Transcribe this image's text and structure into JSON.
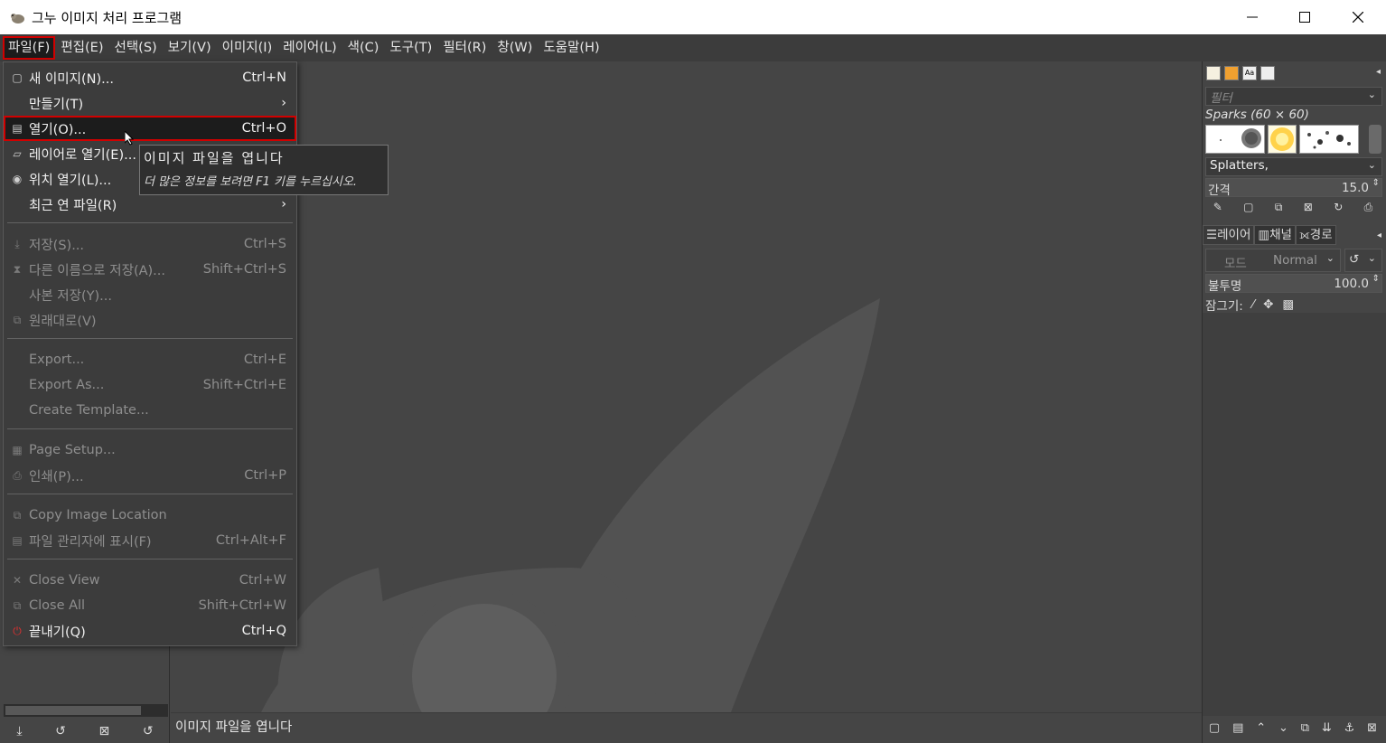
{
  "window": {
    "title": "그누 이미지 처리 프로그램"
  },
  "menubar": [
    {
      "label": "파일(F)",
      "active": true
    },
    {
      "label": "편집(E)"
    },
    {
      "label": "선택(S)"
    },
    {
      "label": "보기(V)"
    },
    {
      "label": "이미지(I)"
    },
    {
      "label": "레이어(L)"
    },
    {
      "label": "색(C)"
    },
    {
      "label": "도구(T)"
    },
    {
      "label": "필터(R)"
    },
    {
      "label": "창(W)"
    },
    {
      "label": "도움말(H)"
    }
  ],
  "file_menu": {
    "items": [
      {
        "label": "새 이미지(N)...",
        "shortcut": "Ctrl+N",
        "icon": "new-image-icon"
      },
      {
        "label": "만들기(T)",
        "shortcut": "",
        "submenu": true
      },
      {
        "label": "열기(O)...",
        "shortcut": "Ctrl+O",
        "icon": "open-icon",
        "highlighted": true
      },
      {
        "label": "레이어로 열기(E)...",
        "shortcut": "",
        "icon": "open-as-layers-icon"
      },
      {
        "label": "위치 열기(L)...",
        "shortcut": "",
        "icon": "open-location-icon"
      },
      {
        "label": "최근 연 파일(R)",
        "shortcut": "",
        "submenu": true
      },
      {
        "label": "저장(S)...",
        "shortcut": "Ctrl+S",
        "icon": "save-icon",
        "disabled": true
      },
      {
        "label": "다른 이름으로 저장(A)...",
        "shortcut": "Shift+Ctrl+S",
        "icon": "save-as-icon",
        "disabled": true
      },
      {
        "label": "사본 저장(Y)...",
        "shortcut": "",
        "disabled": true
      },
      {
        "label": "원래대로(V)",
        "shortcut": "",
        "icon": "revert-icon",
        "disabled": true
      },
      {
        "label": "Export...",
        "shortcut": "Ctrl+E",
        "disabled": true
      },
      {
        "label": "Export As...",
        "shortcut": "Shift+Ctrl+E",
        "disabled": true
      },
      {
        "label": "Create Template...",
        "shortcut": "",
        "disabled": true
      },
      {
        "label": "Page Setup...",
        "shortcut": "",
        "icon": "page-setup-icon",
        "disabled": true
      },
      {
        "label": "인쇄(P)...",
        "shortcut": "Ctrl+P",
        "icon": "print-icon",
        "disabled": true
      },
      {
        "label": "Copy Image Location",
        "shortcut": "",
        "icon": "copy-location-icon",
        "disabled": true
      },
      {
        "label": "파일 관리자에 표시(F)",
        "shortcut": "Ctrl+Alt+F",
        "icon": "file-manager-icon",
        "disabled": true
      },
      {
        "label": "Close View",
        "shortcut": "Ctrl+W",
        "icon": "close-view-icon",
        "disabled": true
      },
      {
        "label": "Close All",
        "shortcut": "Shift+Ctrl+W",
        "icon": "close-all-icon",
        "disabled": true
      },
      {
        "label": "끝내기(Q)",
        "shortcut": "Ctrl+Q",
        "icon": "quit-icon"
      }
    ]
  },
  "tooltip": {
    "title": "이미지 파일을 엽니다",
    "hint": "더 많은 정보를 보려면 F1 키를 누르십시오."
  },
  "statusbar": {
    "text": "이미지 파일을 엽니다"
  },
  "brushes": {
    "filter_placeholder": "필터",
    "brush_name": "Sparks (60 × 60)",
    "tag": "Splatters,",
    "spacing_label": "간격",
    "spacing_value": "15.0"
  },
  "layers": {
    "tabs": [
      "레이어",
      "채널",
      "경로"
    ],
    "mode_label": "모드",
    "mode_value": "Normal",
    "opacity_label": "불투명",
    "opacity_value": "100.0",
    "lock_label": "잠그기:"
  },
  "colors": {
    "highlight_border": "#d10000",
    "menu_bg": "#3c3c3c",
    "canvas_bg": "#454545"
  }
}
